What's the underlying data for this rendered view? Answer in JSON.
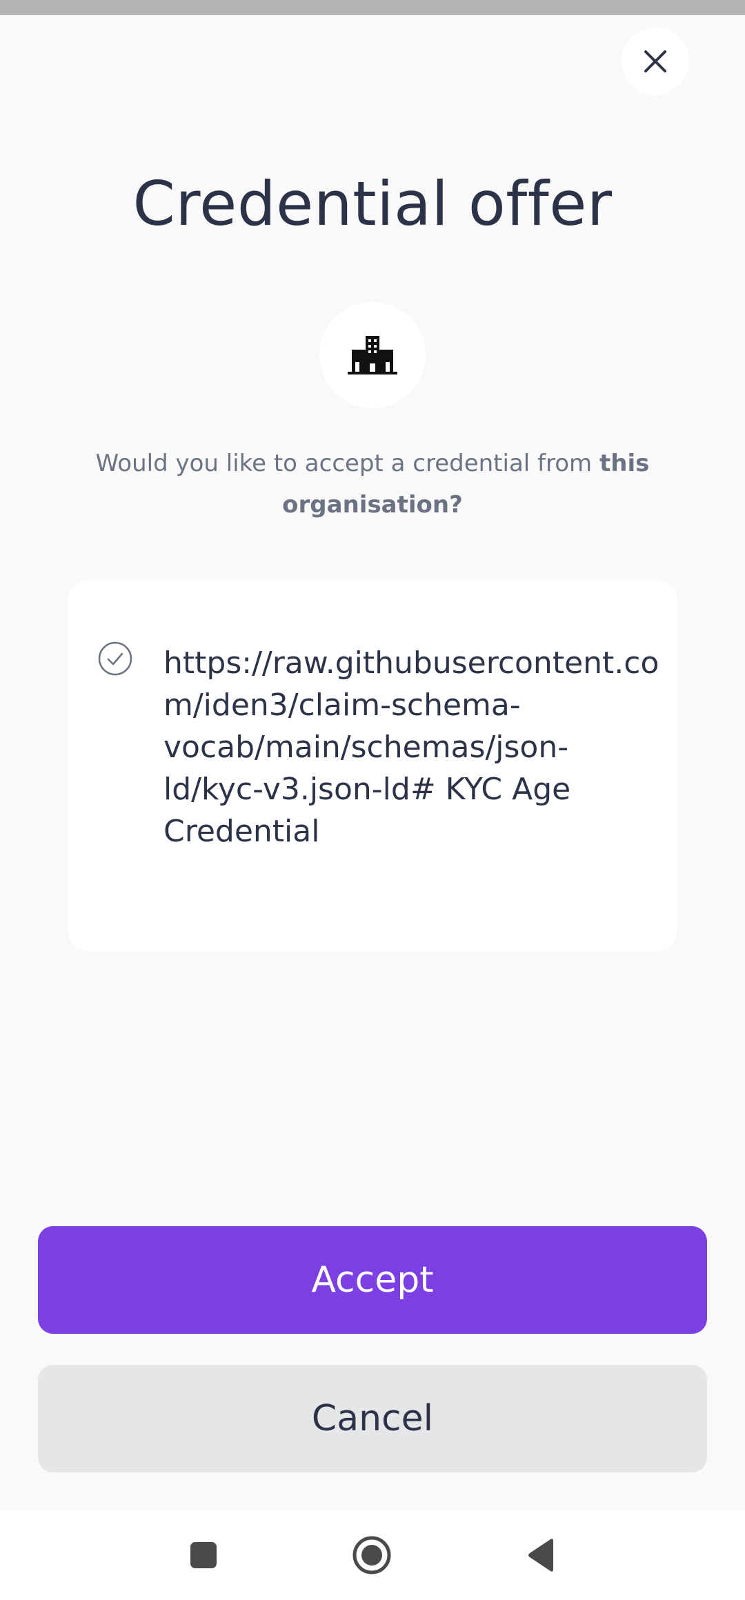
{
  "dialog": {
    "title": "Credential offer",
    "close_icon": "close-icon",
    "org_icon": "building-icon",
    "question_prefix": "Would you like to accept a credential from ",
    "question_bold": "this organisation?",
    "credential": {
      "check_icon": "check-circle-icon",
      "text": "https://raw.githubusercontent.com/iden3/claim-schema-vocab/main/schemas/json-ld/kyc-v3.json-ld# KYC Age Credential"
    },
    "accept_label": "Accept",
    "cancel_label": "Cancel"
  },
  "navigation": {
    "recents_icon": "square-icon",
    "home_icon": "circle-icon",
    "back_icon": "triangle-back-icon"
  },
  "colors": {
    "accent": "#7b3fe4",
    "title_text": "#2c3348",
    "secondary_text": "#6b7283",
    "cancel_bg": "#e5e6e8",
    "background": "#f9f9f9"
  }
}
